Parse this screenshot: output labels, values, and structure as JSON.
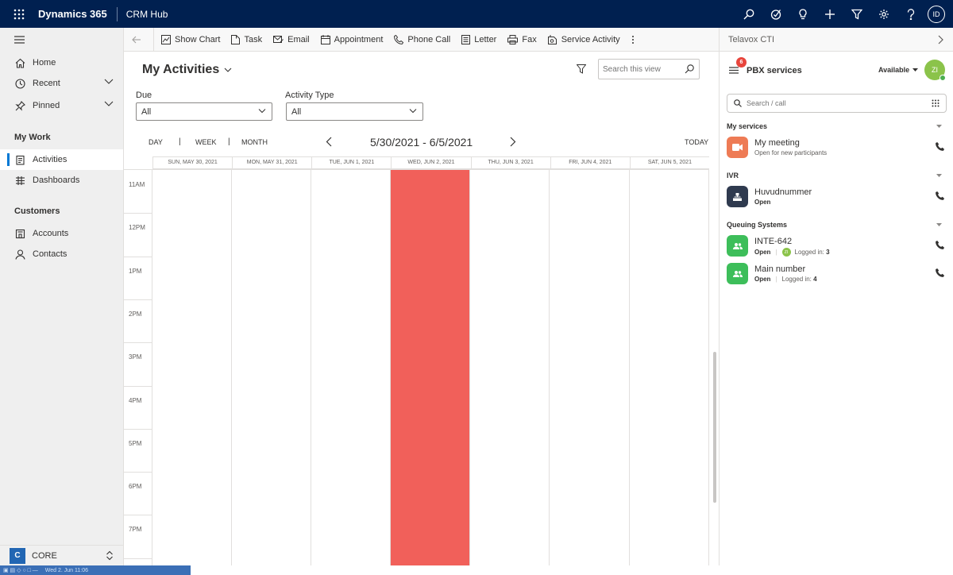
{
  "topbar": {
    "brand": "Dynamics 365",
    "app": "CRM Hub",
    "user_initials": "ID"
  },
  "nav": {
    "home": "Home",
    "recent": "Recent",
    "pinned": "Pinned",
    "group_mywork": "My Work",
    "activities": "Activities",
    "dashboards": "Dashboards",
    "group_customers": "Customers",
    "accounts": "Accounts",
    "contacts": "Contacts",
    "area_badge": "C",
    "area_name": "CORE"
  },
  "commands": {
    "show_chart": "Show Chart",
    "task": "Task",
    "email": "Email",
    "appointment": "Appointment",
    "phone_call": "Phone Call",
    "letter": "Letter",
    "fax": "Fax",
    "service_activity": "Service Activity"
  },
  "view": {
    "title": "My Activities",
    "search_placeholder": "Search this view",
    "due_label": "Due",
    "due_value": "All",
    "type_label": "Activity Type",
    "type_value": "All"
  },
  "calendar": {
    "modes": [
      "DAY",
      "WEEK",
      "MONTH"
    ],
    "range": "5/30/2021 - 6/5/2021",
    "today": "TODAY",
    "days": [
      "SUN, MAY 30, 2021",
      "MON, MAY 31, 2021",
      "TUE, JUN 1, 2021",
      "WED, JUN 2, 2021",
      "THU, JUN 3, 2021",
      "FRI, JUN 4, 2021",
      "SAT, JUN 5, 2021"
    ],
    "today_index": 3,
    "hours": [
      "11AM",
      "12PM",
      "1PM",
      "2PM",
      "3PM",
      "4PM",
      "5PM",
      "6PM",
      "7PM"
    ],
    "today_color": "#F1605A"
  },
  "cti": {
    "header": "Telavox CTI",
    "pbx_title": "PBX services",
    "badge": "6",
    "status": "Available",
    "avatar": "ZI",
    "search_placeholder": "Search / call",
    "sec_my_services": "My services",
    "sec_ivr": "IVR",
    "sec_queuing": "Queuing Systems",
    "services": [
      {
        "name": "My meeting",
        "sub": "Open for new participants",
        "color": "#EE7B55"
      },
      {
        "name": "Huvudnummer",
        "status": "Open",
        "color": "#2F3A4F"
      },
      {
        "name": "INTE-642",
        "status": "Open",
        "agent": "ZI",
        "logged_label": "Logged in:",
        "logged": "3",
        "color": "#3DBE5A"
      },
      {
        "name": "Main number",
        "status": "Open",
        "logged_label": "Logged in:",
        "logged": "4",
        "color": "#3DBE5A"
      }
    ]
  },
  "taskbar": {
    "clock": "Wed 2. Jun  11:06"
  }
}
